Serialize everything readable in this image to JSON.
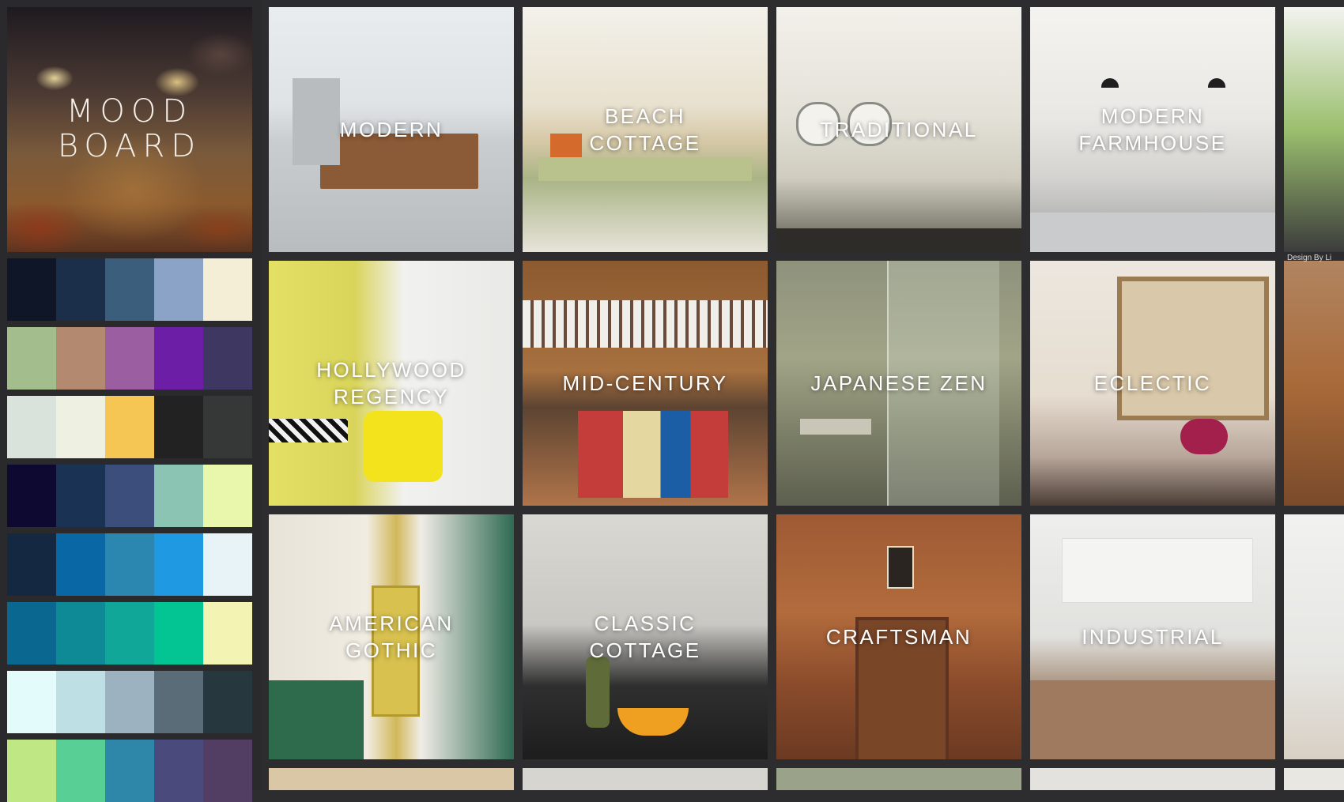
{
  "sidebar": {
    "hero_title": "MOOD\nBOARD",
    "palettes": [
      [
        "#0f1627",
        "#1b2e4a",
        "#3b5e7d",
        "#8aa3c6",
        "#f4eed6"
      ],
      [
        "#a3bd8c",
        "#b38a70",
        "#9b5fa1",
        "#6c1fa6",
        "#3d3762"
      ],
      [
        "#d9e3dc",
        "#eef1e2",
        "#f6c655",
        "#222222",
        "#363838"
      ],
      [
        "#0e0931",
        "#1a3254",
        "#3c4e7c",
        "#8bc4b2",
        "#e8f7ab"
      ],
      [
        "#152842",
        "#0a67a5",
        "#2b87b0",
        "#1f9ae2",
        "#e8f3f7"
      ],
      [
        "#0a678f",
        "#0d8a95",
        "#11a798",
        "#02c593",
        "#f3f4b3"
      ],
      [
        "#e3fbfb",
        "#bedfe4",
        "#9db2c0",
        "#5a6c78",
        "#26373e"
      ],
      [
        "#bfe783",
        "#57cf95",
        "#2e87a8",
        "#4a4b7c",
        "#523d63"
      ]
    ]
  },
  "grid": {
    "tiles": [
      {
        "label": "MODERN",
        "style": "modern"
      },
      {
        "label": "BEACH\nCOTTAGE",
        "style": "beach"
      },
      {
        "label": "TRADITIONAL",
        "style": "traditional"
      },
      {
        "label": "MODERN\nFARMHOUSE",
        "style": "farmhouse"
      },
      {
        "label": "",
        "style": "partial1"
      },
      {
        "label": "HOLLYWOOD\nREGENCY",
        "style": "hollywood"
      },
      {
        "label": "MID-CENTURY",
        "style": "midcentury"
      },
      {
        "label": "JAPANESE ZEN",
        "style": "zen"
      },
      {
        "label": "ECLECTIC",
        "style": "eclectic"
      },
      {
        "label": "",
        "style": "partial2"
      },
      {
        "label": "AMERICAN\nGOTHIC",
        "style": "gothic"
      },
      {
        "label": "CLASSIC\nCOTTAGE",
        "style": "classic"
      },
      {
        "label": "CRAFTSMAN",
        "style": "craftsman"
      },
      {
        "label": "INDUSTRIAL",
        "style": "industrial"
      },
      {
        "label": "",
        "style": "partial3"
      }
    ],
    "credit_text": "Design By Li"
  }
}
